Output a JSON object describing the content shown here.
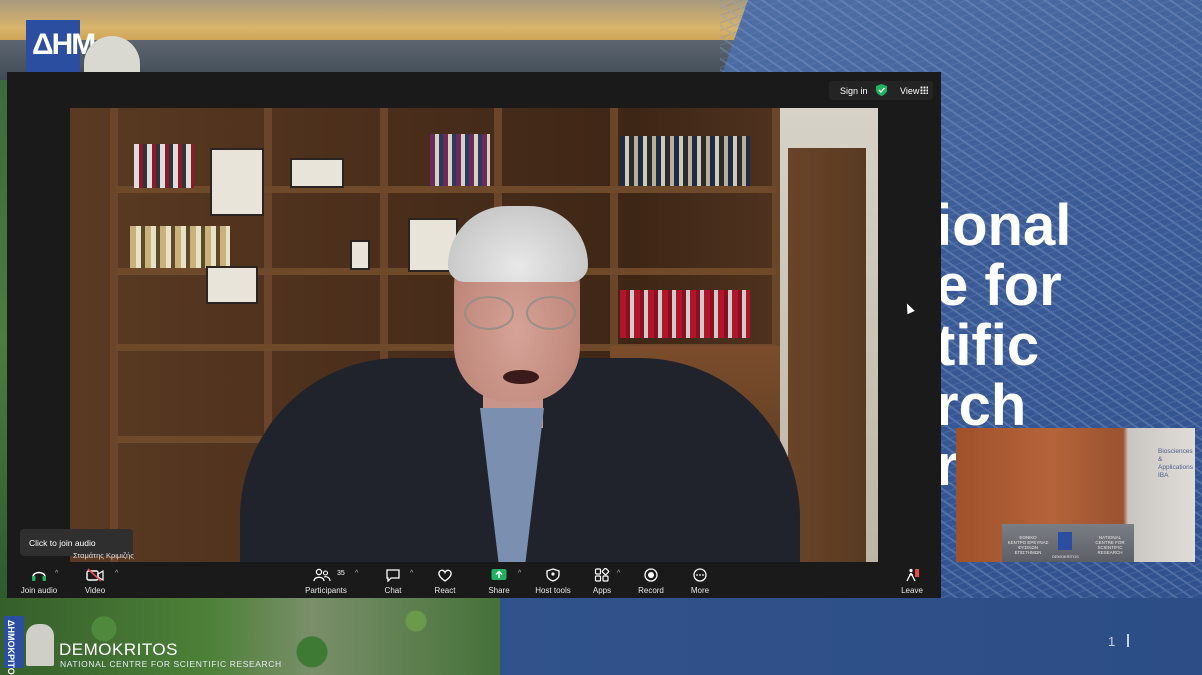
{
  "slide": {
    "logo_letters": "ΔΗΜ",
    "title_lines": [
      "ional",
      "e for",
      "tific",
      "rch",
      "r"
    ],
    "page_number": "1",
    "footer_brand": "DEMOKRITOS",
    "footer_subtitle": "NATIONAL CENTRE FOR SCIENTIFIC RESEARCH",
    "footer_logo_text": "ΔΗΜΟΚΡΙΤΟΣ"
  },
  "topbar": {
    "sign_in": "Sign in",
    "view": "View"
  },
  "video": {
    "tooltip": "Click to join audio",
    "participant_name": "Σταμάτης Κριμιζής"
  },
  "toolbar": {
    "join_audio": "Join audio",
    "video": "Video",
    "participants": "Participants",
    "participants_count": "35",
    "chat": "Chat",
    "react": "React",
    "share": "Share",
    "host_tools": "Host tools",
    "apps": "Apps",
    "record": "Record",
    "more": "More",
    "leave": "Leave"
  },
  "pip": {
    "banner_lines": [
      "Biosciences",
      "& Applications",
      "IBA"
    ],
    "sign_left": [
      "ΕΘΝΙΚΟ",
      "ΚΕΝΤΡΟ ΕΡΕΥΝΑΣ",
      "ΦΥΣΙΚΩΝ ΕΠΙΣΤΗΜΩΝ"
    ],
    "sign_right": [
      "NATIONAL",
      "CENTRE FOR",
      "SCIENTIFIC RESEARCH"
    ],
    "logo_caption": "DEMOKRITOS"
  },
  "colors": {
    "accent_green": "#22b35e",
    "leave_red": "#e5484d",
    "share_green": "#1fb160"
  }
}
